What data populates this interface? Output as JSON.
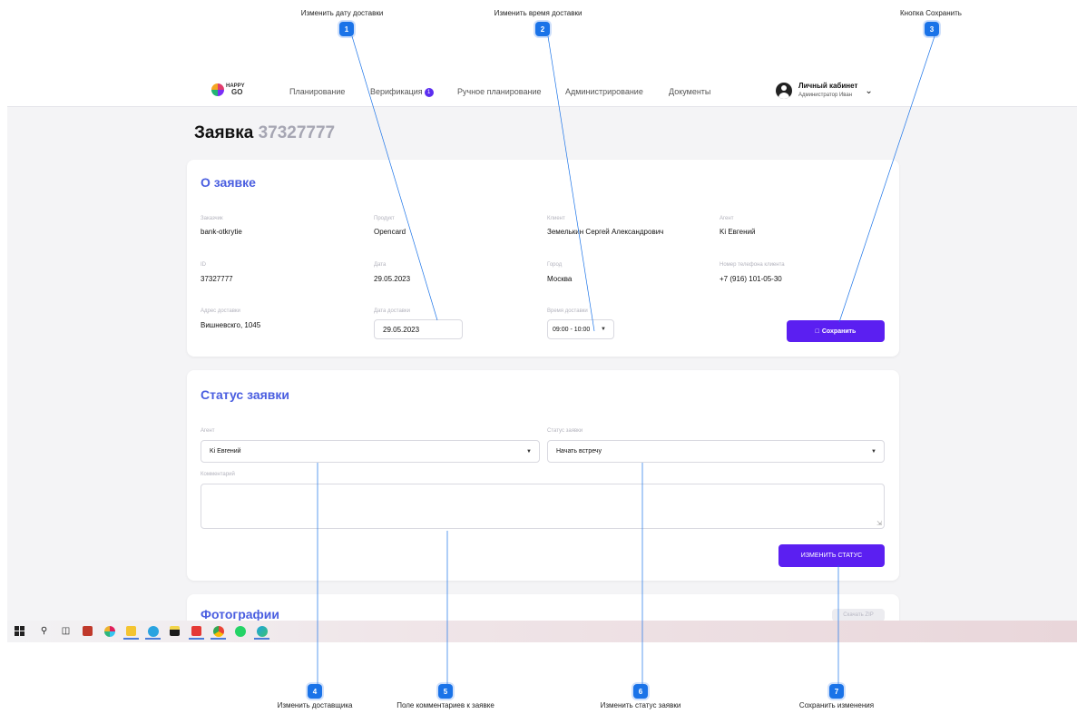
{
  "annotations": {
    "top": [
      {
        "num": "1",
        "label": "Изменить дату доставки"
      },
      {
        "num": "2",
        "label": "Изменить время доставки"
      },
      {
        "num": "3",
        "label": "Кнопка Сохранить"
      }
    ],
    "bottom": [
      {
        "num": "4",
        "label": "Изменить доставщика"
      },
      {
        "num": "5",
        "label": "Поле комментариев к заявке"
      },
      {
        "num": "6",
        "label": "Изменить статус заявки"
      },
      {
        "num": "7",
        "label": "Сохранить изменения"
      }
    ]
  },
  "navbar": {
    "logo_text_top": "HAPPY",
    "logo_text_bottom": "GO",
    "items": [
      "Планирование",
      "Верификация",
      "Ручное планирование",
      "Администрирование",
      "Документы"
    ],
    "verification_badge": "1",
    "account_title": "Личный кабинет",
    "account_sub": "Администратор Иван"
  },
  "page": {
    "title": "Заявка",
    "number": "37327777"
  },
  "order_card": {
    "title": "О заявке",
    "fields": {
      "customer": {
        "label": "Заказчик",
        "value": "bank-otkrytie"
      },
      "product": {
        "label": "Продукт",
        "value": "Opencard"
      },
      "client": {
        "label": "Клиент",
        "value": "Земелькин Сергей Александрович"
      },
      "agent": {
        "label": "Агент",
        "value": "Ki Евгений"
      },
      "id": {
        "label": "ID",
        "value": "37327777"
      },
      "date": {
        "label": "Дата",
        "value": "29.05.2023"
      },
      "city": {
        "label": "Город",
        "value": "Москва"
      },
      "phone": {
        "label": "Номер телефона клиента",
        "value": "+7 (916) 101-05-30"
      },
      "address": {
        "label": "Адрес доставки",
        "value": "Вишневскго, 1045"
      },
      "delivery_date": {
        "label": "Дата доставки",
        "value": "29.05.2023"
      },
      "delivery_time": {
        "label": "Время доставки",
        "value": "09:00 - 10:00"
      }
    },
    "save_button": "Сохранить"
  },
  "status_card": {
    "title": "Статус заявки",
    "agent_label": "Агент",
    "agent_value": "Ki Евгений",
    "status_label": "Статус заявки",
    "status_value": "Начать встречу",
    "comment_label": "Комментарий",
    "change_button": "ИЗМЕНИТЬ СТАТУС"
  },
  "photos_card": {
    "title": "Фотографии",
    "download_button": "Скачать ZIP"
  },
  "colors": {
    "accent": "#5b1ff1",
    "title_blue": "#4a5ee0",
    "annotation_blue": "#1a73e8"
  }
}
